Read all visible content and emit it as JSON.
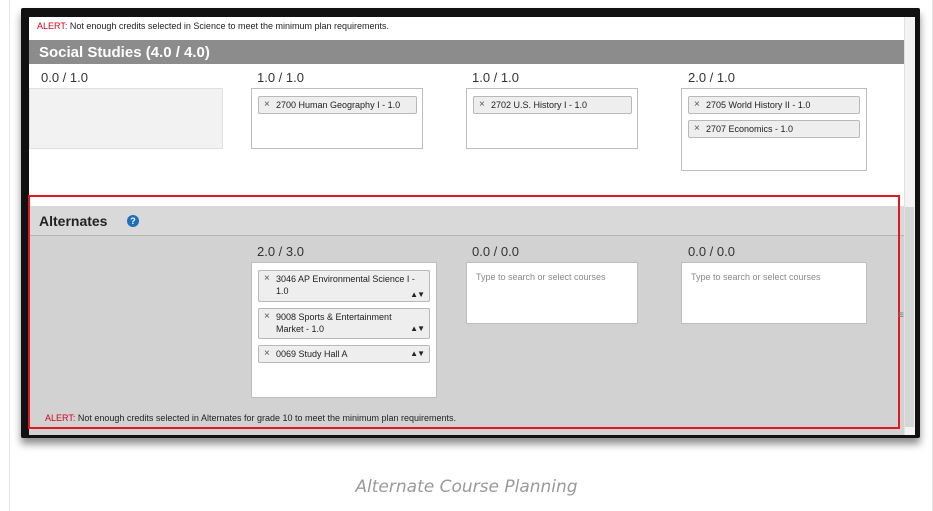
{
  "top_alert": {
    "tag": "ALERT:",
    "text": " Not enough credits selected in Science to meet the minimum plan requirements."
  },
  "social_studies": {
    "title": "Social Studies (4.0 / 4.0)",
    "columns": [
      {
        "label": "0.0 / 1.0",
        "courses": []
      },
      {
        "label": "1.0 / 1.0",
        "courses": [
          "2700 Human Geography I - 1.0"
        ]
      },
      {
        "label": "1.0 / 1.0",
        "courses": [
          "2702 U.S. History I - 1.0"
        ]
      },
      {
        "label": "2.0 / 1.0",
        "courses": [
          "2705 World History II - 1.0",
          "2707 Economics - 1.0"
        ]
      }
    ]
  },
  "alternates": {
    "title": "Alternates",
    "help_icon": "question-circle-icon",
    "columns": [
      {
        "label": "2.0 / 3.0",
        "courses": [
          "3046 AP Environmental Science I - 1.0",
          "9008 Sports & Entertainment Market - 1.0",
          "0069 Study Hall A"
        ]
      },
      {
        "label": "0.0 / 0.0",
        "placeholder": "Type to search or select courses"
      },
      {
        "label": "0.0 / 0.0",
        "placeholder": "Type to search or select courses"
      }
    ],
    "alert": {
      "tag": "ALERT:",
      "text": " Not enough credits selected in Alternates for grade 10 to meet the minimum plan requirements."
    }
  },
  "remove_glyph": "×",
  "reorder_glyph": "▲▼",
  "caption": "Alternate Course Planning",
  "colors": {
    "alert": "#d0021b",
    "section_header": "#8c8c8c",
    "alternates_panel": "#d2d2d2",
    "highlight": "#e2191e",
    "help_icon": "#1e6fb8"
  }
}
